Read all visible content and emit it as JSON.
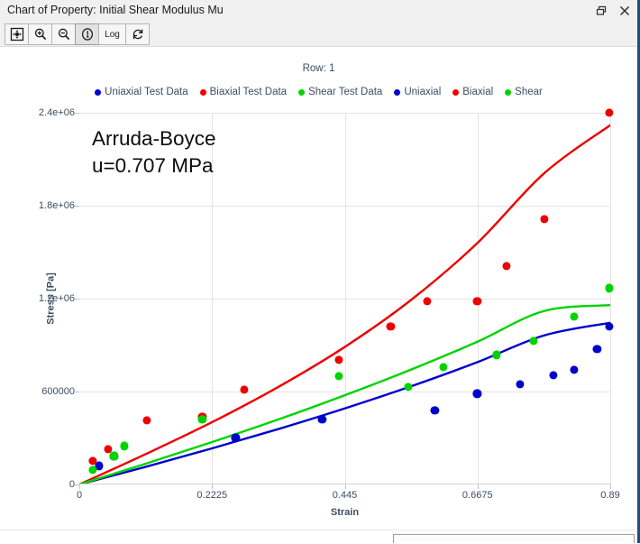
{
  "window": {
    "title": "Chart of Property: Initial Shear Modulus Mu",
    "restore_icon": "restore-window-icon",
    "close_icon": "close-icon",
    "border_color": "#1f4e79"
  },
  "toolbar": {
    "buttons": [
      {
        "name": "fit-to-window-button",
        "label": "",
        "icon": "fit-icon",
        "active": false
      },
      {
        "name": "zoom-in-button",
        "label": "",
        "icon": "magnifier-plus-icon",
        "active": false
      },
      {
        "name": "zoom-out-button",
        "label": "",
        "icon": "magnifier-minus-icon",
        "active": false
      },
      {
        "name": "info-button",
        "label": "",
        "icon": "circled-one-icon",
        "active": true
      },
      {
        "name": "log-scale-button",
        "label": "Log",
        "icon": "",
        "active": false
      },
      {
        "name": "refresh-button",
        "label": "",
        "icon": "refresh-circular-arrows-icon",
        "active": false
      }
    ]
  },
  "chart_header": {
    "row_label": "Row: 1"
  },
  "colors": {
    "blue": "#0000cd",
    "red": "#ee0000",
    "green": "#00d400",
    "text": "#3d4d63",
    "grid": "#e4e4e4"
  },
  "chart_data": {
    "type": "scatter",
    "title": "",
    "annotation": [
      "Arruda-Boyce",
      "u=0.707 MPa"
    ],
    "xlabel": "Strain",
    "ylabel": "Stress [Pa]",
    "xlim": [
      0,
      0.89
    ],
    "ylim": [
      0,
      2400000
    ],
    "xticks": [
      0,
      0.2225,
      0.445,
      0.6675,
      0.89
    ],
    "xtick_labels": [
      "0",
      "0.2225",
      "0.445",
      "0.6675",
      "0.89"
    ],
    "yticks": [
      0,
      600000,
      1200000,
      1800000,
      2400000
    ],
    "ytick_labels": [
      "0",
      "600000",
      "1.2e+06",
      "1.8e+06",
      "2.4e+06"
    ],
    "grid": true,
    "legend_position": "top-center",
    "legend": [
      {
        "label": "Uniaxial Test Data",
        "color": "#0000cd",
        "marker": "circle"
      },
      {
        "label": "Biaxial Test Data",
        "color": "#ee0000",
        "marker": "circle"
      },
      {
        "label": "Shear Test Data",
        "color": "#00d400",
        "marker": "circle"
      },
      {
        "label": "Uniaxial",
        "color": "#0000cd",
        "marker": "line"
      },
      {
        "label": "Biaxial",
        "color": "#ee0000",
        "marker": "line"
      },
      {
        "label": "Shear",
        "color": "#00d400",
        "marker": "line"
      }
    ],
    "series": [
      {
        "name": "Uniaxial Test Data",
        "color": "#0000cd",
        "kind": "scatter",
        "x": [
          0.0,
          0.033,
          0.058,
          0.262,
          0.407,
          0.596,
          0.667,
          0.739,
          0.795,
          0.83,
          0.868,
          0.888
        ],
        "y": [
          0,
          120000,
          182000,
          301000,
          420000,
          480000,
          586000,
          646000,
          704000,
          742000,
          872000,
          1020000
        ]
      },
      {
        "name": "Biaxial Test Data",
        "color": "#ee0000",
        "kind": "scatter",
        "x": [
          0.0,
          0.022,
          0.048,
          0.113,
          0.206,
          0.276,
          0.435,
          0.522,
          0.583,
          0.667,
          0.716,
          0.78,
          0.888
        ],
        "y": [
          0,
          152000,
          230000,
          412000,
          436000,
          612000,
          804000,
          1020000,
          1184000,
          1182000,
          1408000,
          1712000,
          2400000
        ]
      },
      {
        "name": "Shear Test Data",
        "color": "#00d400",
        "kind": "scatter",
        "x": [
          0.0,
          0.022,
          0.058,
          0.075,
          0.206,
          0.435,
          0.552,
          0.61,
          0.7,
          0.762,
          0.83,
          0.888
        ],
        "y": [
          0,
          92000,
          184000,
          248000,
          420000,
          700000,
          628000,
          760000,
          836000,
          928000,
          1084000,
          1268000
        ]
      },
      {
        "name": "Uniaxial",
        "color": "#0000cd",
        "kind": "line",
        "x": [
          0.0,
          0.1113,
          0.2225,
          0.3338,
          0.445,
          0.5563,
          0.6675,
          0.7788,
          0.89
        ],
        "y": [
          0,
          114000,
          233000,
          358000,
          491000,
          634000,
          790000,
          962000,
          1044000
        ]
      },
      {
        "name": "Biaxial",
        "color": "#ee0000",
        "kind": "line",
        "x": [
          0.0,
          0.1113,
          0.2225,
          0.3338,
          0.445,
          0.5563,
          0.6675,
          0.7788,
          0.89
        ],
        "y": [
          0,
          196000,
          402000,
          630000,
          888000,
          1192000,
          1560000,
          2008000,
          2320000
        ]
      },
      {
        "name": "Shear",
        "color": "#00d400",
        "kind": "line",
        "x": [
          0.0,
          0.1113,
          0.2225,
          0.3338,
          0.445,
          0.5563,
          0.6675,
          0.7788,
          0.89
        ],
        "y": [
          0,
          134000,
          274000,
          420000,
          576000,
          742000,
          922000,
          1120000,
          1158000
        ]
      }
    ]
  }
}
